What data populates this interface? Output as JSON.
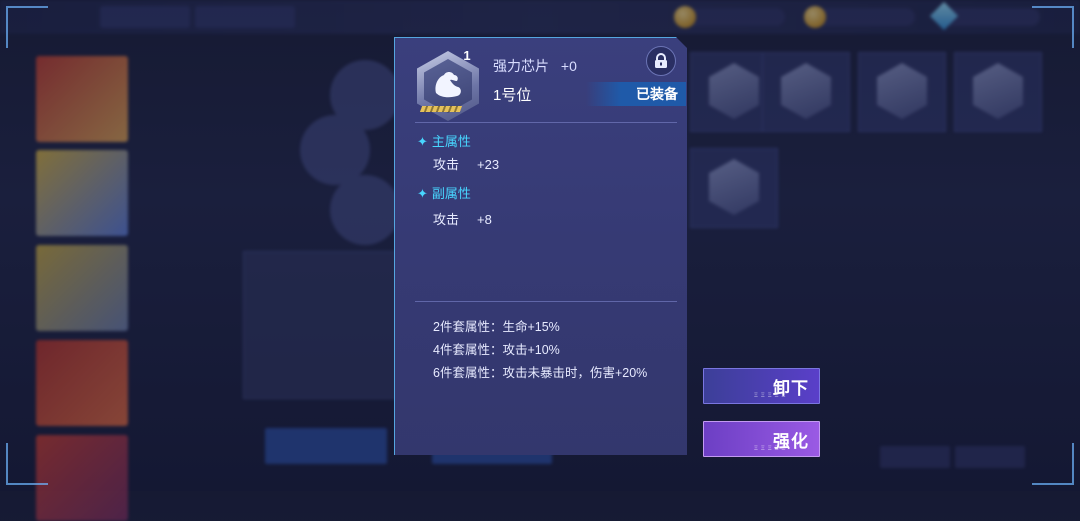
{
  "popup": {
    "chip_level": "1",
    "chip_name": "强力芯片",
    "chip_plus": "+0",
    "slot": "1号位",
    "equipped": "已装备",
    "main_attr": {
      "title": "主属性",
      "stat_name": "攻击",
      "stat_value": "+23"
    },
    "sub_attr": {
      "title": "副属性",
      "stat_name": "攻击",
      "stat_value": "+8"
    },
    "set_bonuses": [
      "2件套属性：生命+15%",
      "4件套属性：攻击+10%",
      "6件套属性：攻击未暴击时，伤害+20%"
    ],
    "icons": {
      "chip": "muscle-arm-icon",
      "lock": "lock-icon",
      "section": "four-point-star-icon"
    }
  },
  "actions": {
    "unload": "卸下",
    "enhance": "强化"
  },
  "colors": {
    "accent_cyan": "#48d6ff",
    "popup_bg": "#383c78",
    "equipped_tag": "#1f5aa9",
    "unload_btn": "#4a3fb5",
    "enhance_btn": "#8a50dc"
  }
}
